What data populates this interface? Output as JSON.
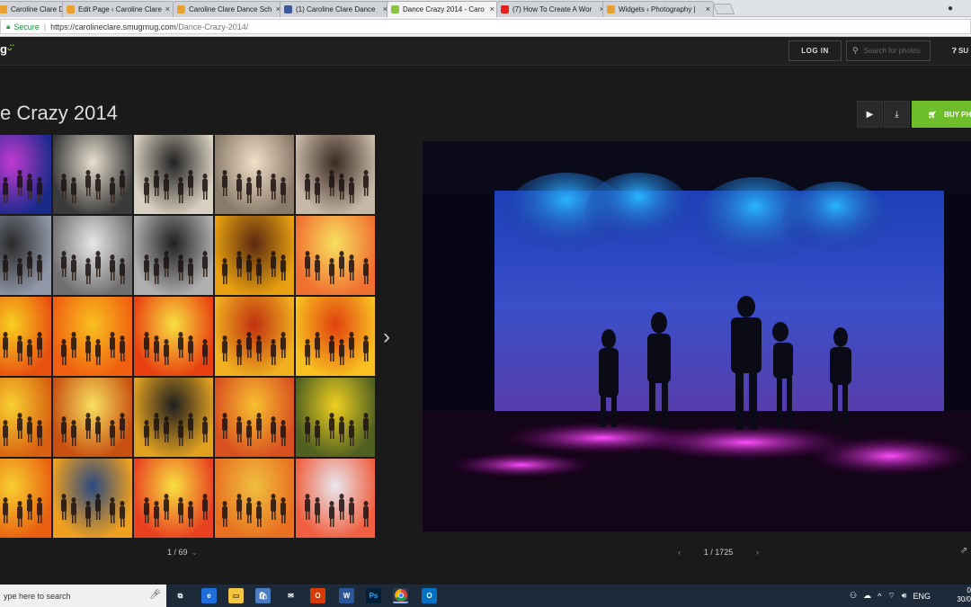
{
  "browser": {
    "tabs": [
      {
        "label": "Caroline Clare Dan",
        "favicon_color": "#e8a030",
        "active": false
      },
      {
        "label": "Edit Page ‹ Caroline Clare",
        "favicon_color": "#e8a030",
        "active": false
      },
      {
        "label": "Caroline Clare Dance Sch",
        "favicon_color": "#e8a030",
        "active": false
      },
      {
        "label": "(1) Caroline Clare Dance",
        "favicon_color": "#3b5998",
        "active": false
      },
      {
        "label": "Dance Crazy 2014 - Caro",
        "favicon_color": "#8ac43f",
        "active": true
      },
      {
        "label": "(7) How To Create A Wor",
        "favicon_color": "#e62117",
        "active": false
      },
      {
        "label": "Widgets ‹ Photography |",
        "favicon_color": "#e8a030",
        "active": false
      }
    ],
    "secure_label": "Secure",
    "url_host": "https://carolineclare.smugmug.com",
    "url_path": "/Dance-Crazy-2014/"
  },
  "header": {
    "logo_text": "g",
    "login_label": "LOG IN",
    "search_placeholder": "Search for photos",
    "support_label": "SU"
  },
  "gallery": {
    "title": "e Crazy 2014",
    "buy_label": "BUY PH",
    "grid_page": "1 / 69",
    "photo_counter": "1 / 1725",
    "accent_color": "#6ebd2a"
  },
  "taskbar": {
    "search_placeholder": "ype here to search",
    "language": "ENG",
    "clock_time": "0",
    "clock_date": "30/0",
    "apps": [
      "task-view",
      "edge",
      "file-explorer",
      "store",
      "mail",
      "office",
      "word",
      "photoshop",
      "chrome",
      "outlook"
    ]
  }
}
